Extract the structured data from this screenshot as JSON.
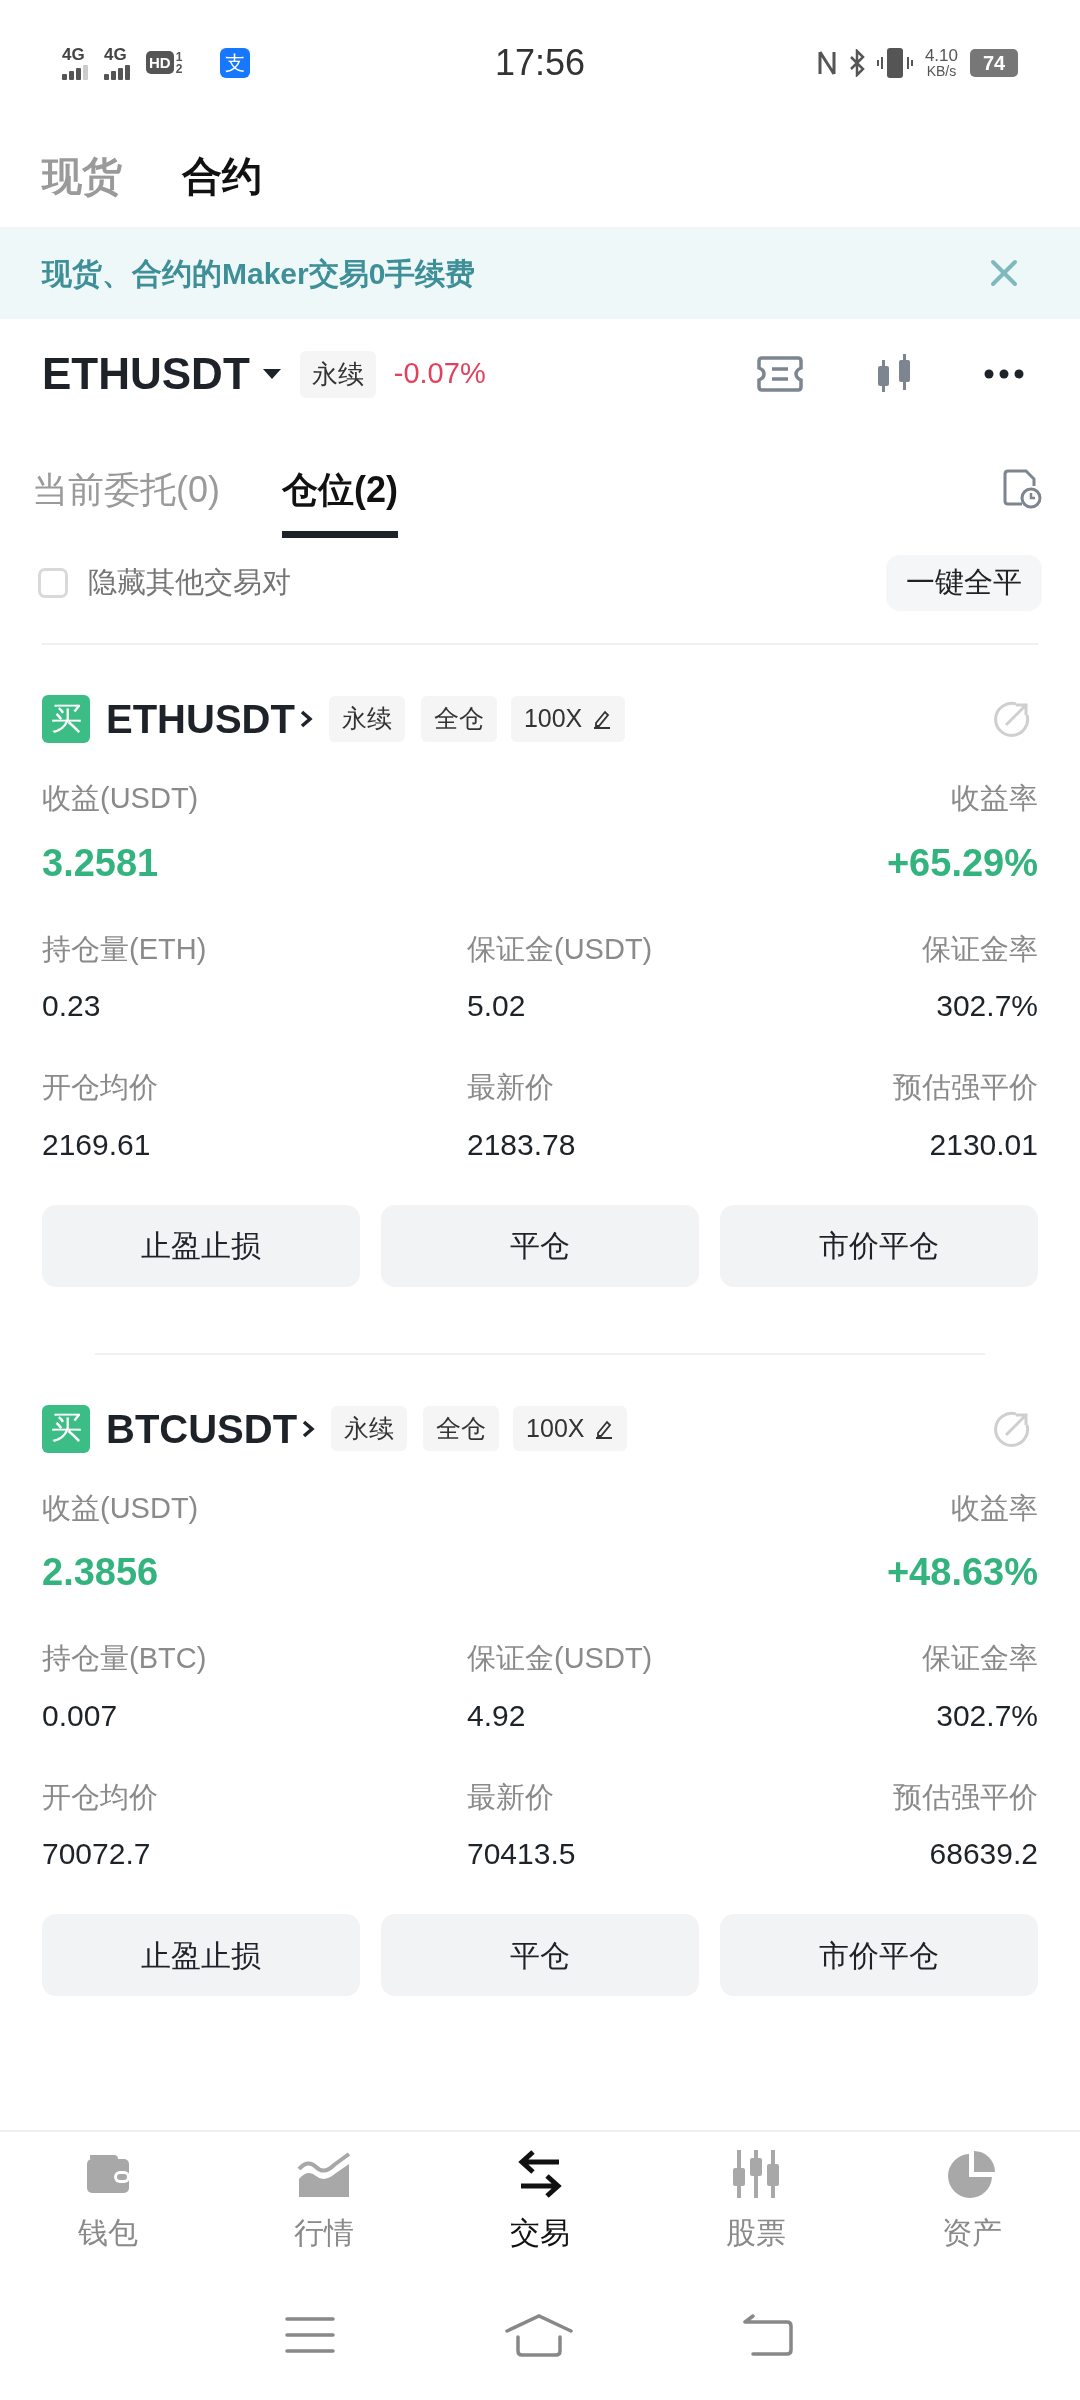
{
  "status_bar": {
    "signals": [
      {
        "label": "4G",
        "level": 0.75
      },
      {
        "label": "4G",
        "level": 1
      }
    ],
    "hd_label": "HD",
    "hd_sims": [
      "1",
      "2"
    ],
    "app_glyph": "支",
    "time": "17:56",
    "speed_value": "4.10",
    "speed_unit": "KB/s",
    "battery": "74"
  },
  "market_tabs": [
    {
      "label": "现货",
      "selected": false
    },
    {
      "label": "合约",
      "selected": true
    }
  ],
  "banner": {
    "text": "现货、合约的Maker交易0手续费"
  },
  "pair": {
    "symbol": "ETHUSDT",
    "tag": "永续",
    "change": "-0.07%"
  },
  "position_tabs": [
    {
      "label": "当前委托(0)",
      "selected": false
    },
    {
      "label": "仓位(2)",
      "selected": true
    }
  ],
  "hide_others": {
    "label": "隐藏其他交易对",
    "checked": false
  },
  "close_all_button": "一键全平",
  "positions": [
    {
      "side": "买",
      "symbol": "ETHUSDT",
      "tags": [
        "永续",
        "全仓"
      ],
      "leverage": "100X",
      "pnl_label": "收益(USDT)",
      "pnl": "3.2581",
      "roe_label": "收益率",
      "roe": "+65.29%",
      "fields": [
        {
          "label": "持仓量(ETH)",
          "value": "0.23"
        },
        {
          "label": "保证金(USDT)",
          "value": "5.02"
        },
        {
          "label": "保证金率",
          "value": "302.7%"
        },
        {
          "label": "开仓均价",
          "value": "2169.61"
        },
        {
          "label": "最新价",
          "value": "2183.78"
        },
        {
          "label": "预估强平价",
          "value": "2130.01"
        }
      ],
      "buttons": [
        "止盈止损",
        "平仓",
        "市价平仓"
      ]
    },
    {
      "side": "买",
      "symbol": "BTCUSDT",
      "tags": [
        "永续",
        "全仓"
      ],
      "leverage": "100X",
      "pnl_label": "收益(USDT)",
      "pnl": "2.3856",
      "roe_label": "收益率",
      "roe": "+48.63%",
      "fields": [
        {
          "label": "持仓量(BTC)",
          "value": "0.007"
        },
        {
          "label": "保证金(USDT)",
          "value": "4.92"
        },
        {
          "label": "保证金率",
          "value": "302.7%"
        },
        {
          "label": "开仓均价",
          "value": "70072.7"
        },
        {
          "label": "最新价",
          "value": "70413.5"
        },
        {
          "label": "预估强平价",
          "value": "68639.2"
        }
      ],
      "buttons": [
        "止盈止损",
        "平仓",
        "市价平仓"
      ]
    }
  ],
  "bottom_nav": [
    {
      "label": "钱包",
      "kind": "wallet",
      "selected": false
    },
    {
      "label": "行情",
      "kind": "market",
      "selected": false
    },
    {
      "label": "交易",
      "kind": "trade",
      "selected": true
    },
    {
      "label": "股票",
      "kind": "stocks",
      "selected": false
    },
    {
      "label": "资产",
      "kind": "assets",
      "selected": false
    }
  ]
}
